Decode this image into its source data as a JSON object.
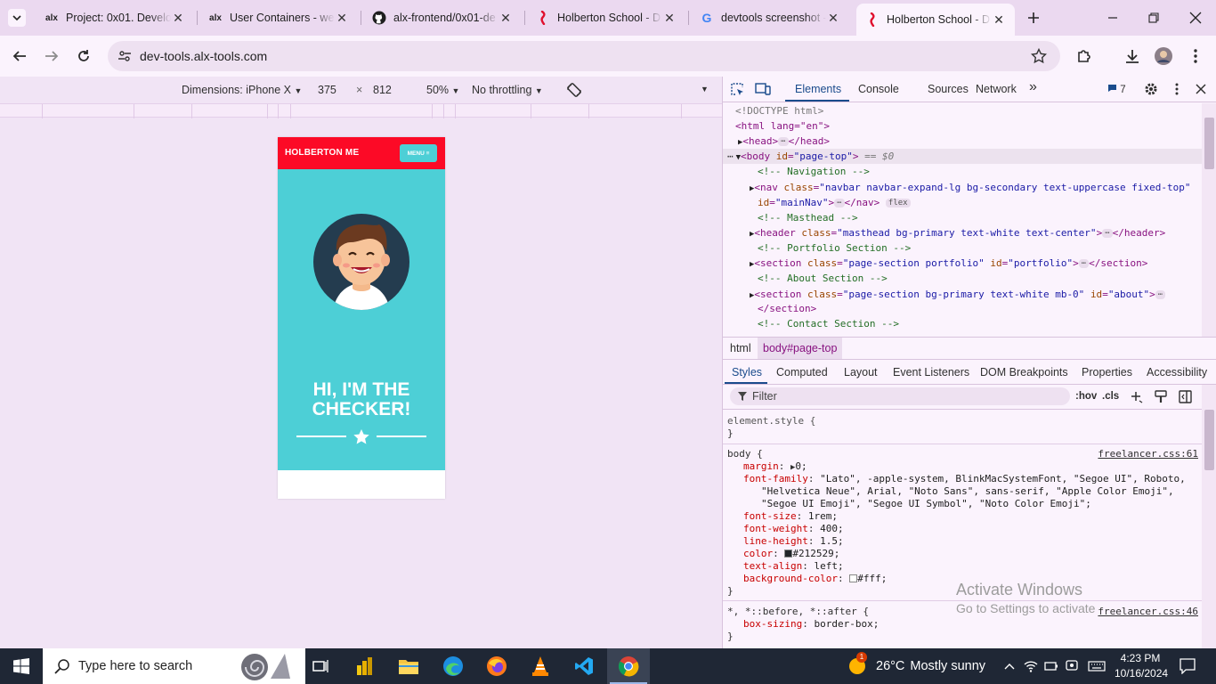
{
  "tabs": [
    {
      "title": "Project: 0x01. Develop",
      "favicon": "alx-logo",
      "favicon_text": "alx"
    },
    {
      "title": "User Containers - wel",
      "favicon": "alx-logo",
      "favicon_text": "alx"
    },
    {
      "title": "alx-frontend/0x01-de",
      "favicon": "github-icon"
    },
    {
      "title": "Holberton School - D",
      "favicon": "holberton-icon"
    },
    {
      "title": "devtools screenshot -",
      "favicon": "google-icon",
      "favicon_text": "G"
    },
    {
      "title": "Holberton School - D",
      "favicon": "holberton-icon",
      "active": true
    }
  ],
  "address": {
    "url": "dev-tools.alx-tools.com"
  },
  "device_toolbar": {
    "dimensions_label": "Dimensions: iPhone X",
    "width": "375",
    "times": "×",
    "height": "812",
    "zoom": "50%",
    "throttling": "No throttling"
  },
  "site": {
    "brand": "HOLBERTON ME",
    "menu": "MENU ≡",
    "hero_line1": "HI, I'M THE",
    "hero_line2": "CHECKER!",
    "colors": {
      "navbar": "#fc0a26",
      "masthead": "#4dcfd6"
    }
  },
  "devtools": {
    "tabs": [
      "Elements",
      "Console",
      "Sources",
      "Network"
    ],
    "more": "»",
    "issues_count": "7",
    "dom": {
      "doctype": "<!DOCTYPE html>",
      "html_open": "<html lang=\"en\">",
      "head": "<head>",
      "head_close": "</head>",
      "body_open_tag": "<body",
      "body_attr_name": "id",
      "body_attr_value": "\"page-top\"",
      "body_suffix": "== $0",
      "comment_nav": "<!-- Navigation -->",
      "nav_tag": "<nav",
      "nav_class_value": "\"navbar navbar-expand-lg bg-secondary text-uppercase fixed-top\"",
      "nav_id_value": "\"mainNav\"",
      "nav_close": "</nav>",
      "flex_badge": "flex",
      "comment_masthead": "<!-- Masthead -->",
      "header_tag": "<header",
      "header_class_value": "\"masthead bg-primary text-white text-center\"",
      "header_close": "</header>",
      "comment_portfolio": "<!-- Portfolio Section -->",
      "section1_class_value": "\"page-section portfolio\"",
      "section1_id_value": "\"portfolio\"",
      "section_close": "</section>",
      "comment_about": "<!-- About Section -->",
      "section2_class_value": "\"page-section bg-primary text-white mb-0\"",
      "section2_id_value": "\"about\"",
      "comment_contact": "<!-- Contact Section -->"
    },
    "breadcrumbs": [
      "html",
      "body#page-top"
    ],
    "sub_tabs": [
      "Styles",
      "Computed",
      "Layout",
      "Event Listeners",
      "DOM Breakpoints",
      "Properties",
      "Accessibility"
    ],
    "filter_placeholder": "Filter",
    "hov": ":hov",
    "cls": ".cls",
    "styles": {
      "element_style": "element.style {",
      "close": "}",
      "body_selector": "body {",
      "body_source": "freelancer.css:61",
      "props": [
        {
          "name": "margin",
          "value": "0;"
        },
        {
          "name": "font-family",
          "value": "\"Lato\", -apple-system, BlinkMacSystemFont, \"Segoe UI\", Roboto,"
        },
        {
          "name": "",
          "value": "\"Helvetica Neue\", Arial, \"Noto Sans\", sans-serif, \"Apple Color Emoji\","
        },
        {
          "name": "",
          "value": "\"Segoe UI Emoji\", \"Segoe UI Symbol\", \"Noto Color Emoji\";"
        },
        {
          "name": "font-size",
          "value": "1rem;"
        },
        {
          "name": "font-weight",
          "value": "400;"
        },
        {
          "name": "line-height",
          "value": "1.5;"
        },
        {
          "name": "color",
          "value": "#212529;"
        },
        {
          "name": "text-align",
          "value": "left;"
        },
        {
          "name": "background-color",
          "value": "#fff;"
        }
      ],
      "universal_selector": "*, *::before, *::after {",
      "universal_source": "freelancer.css:46",
      "box_sizing": {
        "name": "box-sizing",
        "value": "border-box;"
      }
    },
    "watermark_line1": "Activate Windows",
    "watermark_line2": "Go to Settings to activate Windows."
  },
  "taskbar": {
    "search_placeholder": "Type here to search",
    "weather_temp": "26°C",
    "weather_desc": "Mostly sunny",
    "weather_badge": "1",
    "time": "4:23 PM",
    "date": "10/16/2024"
  }
}
